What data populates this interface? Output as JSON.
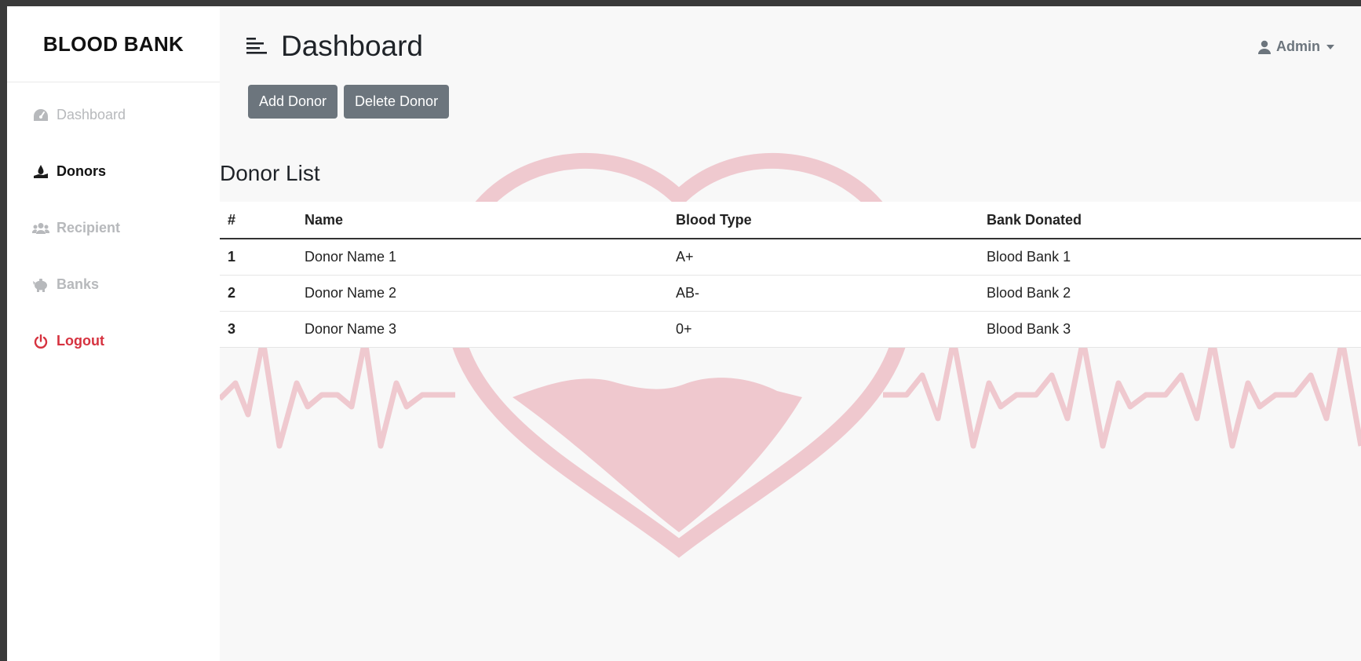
{
  "sidebar": {
    "brand": "BLOOD BANK",
    "items": [
      {
        "label": "Dashboard",
        "icon": "gauge-icon"
      },
      {
        "label": "Donors",
        "icon": "hand-holding-drop-icon"
      },
      {
        "label": "Recipient",
        "icon": "users-icon"
      },
      {
        "label": "Banks",
        "icon": "piggy-bank-icon"
      },
      {
        "label": "Logout",
        "icon": "power-icon"
      }
    ]
  },
  "header": {
    "title": "Dashboard",
    "user_label": "Admin"
  },
  "actions": {
    "add_label": "Add Donor",
    "delete_label": "Delete Donor"
  },
  "donor_list": {
    "title": "Donor List",
    "columns": [
      "#",
      "Name",
      "Blood Type",
      "Bank Donated"
    ],
    "rows": [
      [
        "1",
        "Donor Name 1",
        "A+",
        "Blood Bank 1"
      ],
      [
        "2",
        "Donor Name 2",
        "AB-",
        "Blood Bank 2"
      ],
      [
        "3",
        "Donor Name 3",
        "0+",
        "Blood Bank 3"
      ]
    ]
  },
  "colors": {
    "sidebar_bg": "#ffffff",
    "button_bg": "#6c757d",
    "logout": "#d6323f",
    "hero_heart": "#e8a2ad"
  }
}
